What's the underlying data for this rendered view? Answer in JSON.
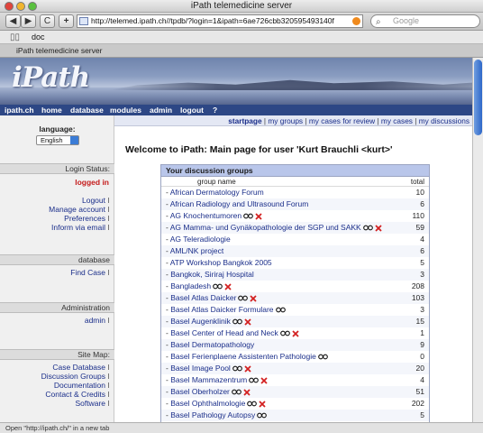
{
  "window": {
    "title": "iPath telemedicine server"
  },
  "toolbar": {
    "back_label": "◀",
    "forward_label": "▶",
    "reload_label": "C",
    "add_label": "+",
    "url": "http://telemed.ipath.ch//tpdb/?login=1&ipath=6ae726cbb320595493140f",
    "search_placeholder": "Google"
  },
  "bookmarks": {
    "items": [
      "doc"
    ]
  },
  "tabs": [
    {
      "label": "iPath telemedicine server"
    }
  ],
  "site": {
    "logo": "iPath",
    "nav": [
      "ipath.ch",
      "home",
      "database",
      "modules",
      "admin",
      "logout",
      "?"
    ],
    "sublinks": [
      "startpage",
      "my groups",
      "my cases for review",
      "my cases",
      "my discussions"
    ]
  },
  "sidebar": {
    "language_label": "language:",
    "language_value": "English",
    "login_header": "Login Status:",
    "login_status": "logged in",
    "account_links": [
      "Logout",
      "Manage account",
      "Preferences",
      "Inform via email"
    ],
    "database_header": "database",
    "database_links": [
      "Find Case"
    ],
    "admin_header": "Administration",
    "admin_links": [
      "admin"
    ],
    "sitemap_header": "Site Map:",
    "sitemap_links": [
      "Case Database",
      "Discussion Groups",
      "Documentation",
      "Contact & Credits",
      "Software"
    ]
  },
  "main": {
    "welcome": "Welcome to iPath: Main page for user 'Kurt Brauchli <kurt>'",
    "groups_header": "Your discussion groups",
    "col_name": "group name",
    "col_total": "total",
    "groups": [
      {
        "name": "African Dermatology Forum",
        "total": "10",
        "glasses": false,
        "cross": false
      },
      {
        "name": "African Radiology and Ultrasound Forum",
        "total": "6",
        "glasses": false,
        "cross": false
      },
      {
        "name": "AG Knochentumoren",
        "total": "110",
        "glasses": true,
        "cross": true
      },
      {
        "name": "AG Mamma- und Gynäkopathologie der SGP und SAKK",
        "total": "59",
        "glasses": true,
        "cross": true
      },
      {
        "name": "AG Teleradiologie",
        "total": "4",
        "glasses": false,
        "cross": false
      },
      {
        "name": "AML/NK project",
        "total": "6",
        "glasses": false,
        "cross": false
      },
      {
        "name": "ATP Workshop Bangkok 2005",
        "total": "5",
        "glasses": false,
        "cross": false
      },
      {
        "name": "Bangkok, Siriraj Hospital",
        "total": "3",
        "glasses": false,
        "cross": false
      },
      {
        "name": "Bangladesh",
        "total": "208",
        "glasses": true,
        "cross": true
      },
      {
        "name": "Basel Atlas Daicker",
        "total": "103",
        "glasses": true,
        "cross": true
      },
      {
        "name": "Basel Atlas Daicker Formulare",
        "total": "3",
        "glasses": true,
        "cross": false
      },
      {
        "name": "Basel Augenklinik",
        "total": "15",
        "glasses": true,
        "cross": true
      },
      {
        "name": "Basel Center of Head and Neck",
        "total": "1",
        "glasses": true,
        "cross": true
      },
      {
        "name": "Basel Dermatopathology",
        "total": "9",
        "glasses": false,
        "cross": false
      },
      {
        "name": "Basel Ferienplaene Assistenten Pathologie",
        "total": "0",
        "glasses": true,
        "cross": false
      },
      {
        "name": "Basel Image Pool",
        "total": "20",
        "glasses": true,
        "cross": true
      },
      {
        "name": "Basel Mammazentrum",
        "total": "4",
        "glasses": true,
        "cross": true
      },
      {
        "name": "Basel Oberholzer",
        "total": "51",
        "glasses": true,
        "cross": true
      },
      {
        "name": "Basel Ophthalmologie",
        "total": "202",
        "glasses": true,
        "cross": true
      },
      {
        "name": "Basel Pathology Autopsy",
        "total": "5",
        "glasses": true,
        "cross": false
      }
    ]
  },
  "status_bar": "Open \"http://ipath.ch/\" in a new tab",
  "colors": {
    "navbar": "#2d4785",
    "link": "#1a2e8a",
    "logged_in": "#c41a1a",
    "group_header": "#b9c6ea",
    "cross": "#d32020"
  }
}
